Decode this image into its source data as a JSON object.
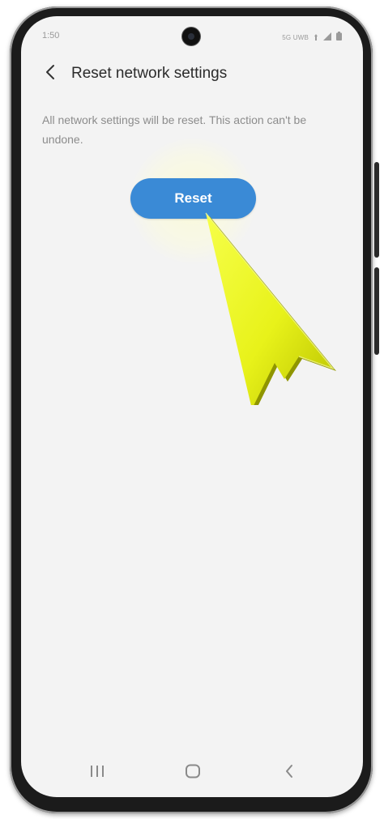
{
  "status_bar": {
    "time": "1:50",
    "network_type": "5G UWB",
    "network_icon": "5g-icon",
    "signal_icon": "signal-icon",
    "battery_icon": "battery-icon"
  },
  "header": {
    "back_icon": "back-arrow-icon",
    "title": "Reset network settings"
  },
  "main": {
    "description": "All network settings will be reset. This action can't be undone.",
    "reset_button_label": "Reset",
    "accent_color": "#3a8ad6",
    "pointer_overlay": "yellow-pointer-arrow",
    "pointer_color": "#e8f21a"
  },
  "nav_bar": {
    "recents_icon": "recents-icon",
    "home_icon": "home-icon",
    "back_icon": "back-icon"
  }
}
